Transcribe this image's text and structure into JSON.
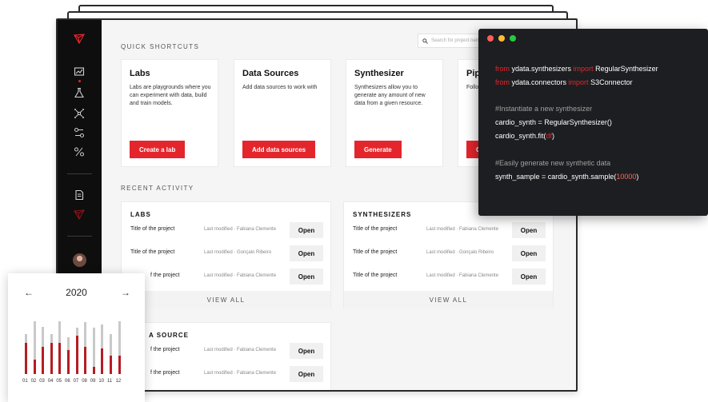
{
  "search": {
    "placeholder": "Search for project name"
  },
  "quick_shortcuts": {
    "title": "QUICK SHORTCUTS",
    "cards": [
      {
        "title": "Labs",
        "desc": "Labs are playgrounds where you can experiment with data, build and train models.",
        "button": "Create a lab"
      },
      {
        "title": "Data Sources",
        "desc": "Add data sources to work with",
        "button": "Add data sources"
      },
      {
        "title": "Synthesizer",
        "desc": "Synthesizers allow you to generate any amount of new data from a given resource.",
        "button": "Generate"
      },
      {
        "title": "Pip",
        "desc": "Follo",
        "button": "C"
      }
    ]
  },
  "recent_activity": {
    "title": "RECENT ACTIVITY",
    "labs": {
      "title": "LABS",
      "rows": [
        {
          "title": "Title of the project",
          "modified": "Last modified · Fabiana Clemente",
          "open": "Open"
        },
        {
          "title": "Title of the project",
          "modified": "Last modified · Gonçalo Ribeiro",
          "open": "Open"
        },
        {
          "title": "f the project",
          "modified": "Last modified · Fabiana Clemente",
          "open": "Open"
        }
      ],
      "view_all": "VIEW ALL"
    },
    "synthesizers": {
      "title": "SYNTHESIZERS",
      "rows": [
        {
          "title": "Title of the project",
          "modified": "Last modified · Fabiana Clemente",
          "open": "Open"
        },
        {
          "title": "Title of the project",
          "modified": "Last modified · Gonçalo Ribeiro",
          "open": "Open"
        },
        {
          "title": "Title of the project",
          "modified": "Last modified · Fabiana Clemente",
          "open": "Open"
        }
      ],
      "view_all": "VIEW ALL"
    },
    "data_source": {
      "title": "A SOURCE",
      "rows": [
        {
          "title": "f the project",
          "modified": "Last modified · Fabiana Clemente",
          "open": "Open"
        },
        {
          "title": "f the project",
          "modified": "Last modified · Fabiana Clemente",
          "open": "Open"
        }
      ]
    }
  },
  "code": {
    "lines": [
      {
        "text": "from ydata.synthesizers import RegularSynthesizer"
      },
      {
        "text": "from ydata.connectors import S3Connector"
      },
      {
        "text": ""
      },
      {
        "text": "#Instantiate a new synthesizer"
      },
      {
        "text": "cardio_synth = RegularSynthesizer()"
      },
      {
        "text": "cardio_synth.fit(df)"
      },
      {
        "text": ""
      },
      {
        "text": "#Easily generate new synthetic data"
      },
      {
        "text": "synth_sample = cardio_synth.sample(10000)"
      }
    ]
  },
  "date_picker": {
    "prev": "←",
    "year": "2020",
    "next": "→",
    "months": [
      "01",
      "02",
      "03",
      "04",
      "05",
      "06",
      "07",
      "08",
      "09",
      "10",
      "11",
      "12"
    ],
    "track_fraction": [
      0.62,
      0.82,
      0.74,
      0.62,
      0.82,
      0.58,
      0.73,
      0.81,
      0.73,
      0.78,
      0.62,
      0.82
    ],
    "fill_fraction": [
      0.49,
      0.22,
      0.42,
      0.49,
      0.49,
      0.38,
      0.6,
      0.42,
      0.11,
      0.4,
      0.29,
      0.29
    ]
  },
  "colors": {
    "accent": "#e4262c",
    "sidebar": "#0e0e0e",
    "code_bg": "#1d1e21",
    "bar_fill": "#b51d22",
    "bar_track": "#c9c9c9"
  }
}
